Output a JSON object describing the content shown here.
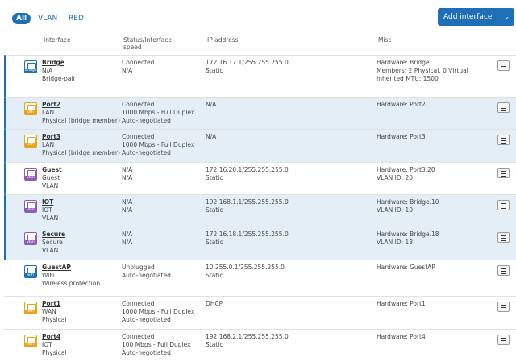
{
  "filters": [
    "All",
    "VLAN",
    "RED"
  ],
  "add_button": {
    "label": "Add interface",
    "chevron": "⌄"
  },
  "columns": {
    "interface": "Interface",
    "status": "Status/Interface speed",
    "ip": "IP address",
    "misc": "Misc"
  },
  "interfaces": [
    {
      "name": "Bridge",
      "line2": "N/A",
      "line3": "Bridge-pair",
      "icon": "bridge-icon",
      "icon_label": "bridge",
      "icon_color": "#1f6fb8",
      "status": [
        "Connected",
        "N/A"
      ],
      "ip": [
        "172.16.17.1/255.255.255.0",
        "Static"
      ],
      "misc": [
        "Hardware:  Bridge",
        "Members:  2 Physical, 0 Virtual",
        "Inherited MTU:  1500"
      ]
    },
    {
      "name": "Port2",
      "line2": "LAN",
      "line3": "Physical (bridge member)",
      "icon": "ethernet-icon",
      "icon_label": "eth",
      "icon_color": "#e8a317",
      "status": [
        "Connected",
        "1000 Mbps - Full Duplex",
        "Auto-negotiated"
      ],
      "ip": [
        "N/A"
      ],
      "misc": [
        "Hardware:  Port2"
      ]
    },
    {
      "name": "Port3",
      "line2": "LAN",
      "line3": "Physical (bridge member)",
      "icon": "ethernet-icon",
      "icon_label": "eth",
      "icon_color": "#e8a317",
      "status": [
        "Connected",
        "1000 Mbps - Full Duplex",
        "Auto-negotiated"
      ],
      "ip": [
        "N/A"
      ],
      "misc": [
        "Hardware:  Port3"
      ]
    },
    {
      "name": "Guest",
      "line2": "Guest",
      "line3": "VLAN",
      "icon": "vlan-icon",
      "icon_label": "vlan",
      "icon_color": "#8e5bb5",
      "status": [
        "N/A",
        "N/A"
      ],
      "ip": [
        "172.16.20.1/255.255.255.0",
        "Static"
      ],
      "misc": [
        "Hardware:  Port3.20",
        "VLAN ID:  20"
      ]
    },
    {
      "name": "IOT",
      "line2": "IOT",
      "line3": "VLAN",
      "icon": "vlan-icon",
      "icon_label": "vlan",
      "icon_color": "#8e5bb5",
      "status": [
        "N/A",
        "N/A"
      ],
      "ip": [
        "192.168.1.1/255.255.255.0",
        "Static"
      ],
      "misc": [
        "Hardware:  Bridge.10",
        "VLAN ID:  10"
      ]
    },
    {
      "name": "Secure",
      "line2": "Secure",
      "line3": "VLAN",
      "icon": "vlan-icon",
      "icon_label": "vlan",
      "icon_color": "#8e5bb5",
      "status": [
        "N/A",
        "N/A"
      ],
      "ip": [
        "172.16.18.1/255.255.255.0",
        "Static"
      ],
      "misc": [
        "Hardware:  Bridge.18",
        "VLAN ID:  18"
      ]
    },
    {
      "name": "GuestAP",
      "line2": "WiFi",
      "line3": "Wireless protection",
      "icon": "wifi-icon",
      "icon_label": "wifi",
      "icon_color": "#1f6fb8",
      "status": [
        "Unplugged",
        "Auto-negotiated"
      ],
      "ip": [
        "10.255.0.1/255.255.255.0",
        "Static"
      ],
      "misc": [
        "Hardware:  GuestAP"
      ]
    },
    {
      "name": "Port1",
      "line2": "WAN",
      "line3": "Physical",
      "icon": "ethernet-icon",
      "icon_label": "eth",
      "icon_color": "#e8a317",
      "status": [
        "Connected",
        "1000 Mbps - Full Duplex",
        "Auto-negotiated"
      ],
      "ip": [
        "DHCP"
      ],
      "misc": [
        "Hardware:  Port1"
      ]
    },
    {
      "name": "Port4",
      "line2": "IOT",
      "line3": "Physical",
      "icon": "ethernet-icon",
      "icon_label": "eth",
      "icon_color": "#e8a317",
      "status": [
        "Connected",
        "100 Mbps - Full Duplex",
        "Auto-negotiated"
      ],
      "ip": [
        "192.168.2.1/255.255.255.0",
        "Static"
      ],
      "misc": [
        "Hardware:  Port4"
      ]
    }
  ]
}
